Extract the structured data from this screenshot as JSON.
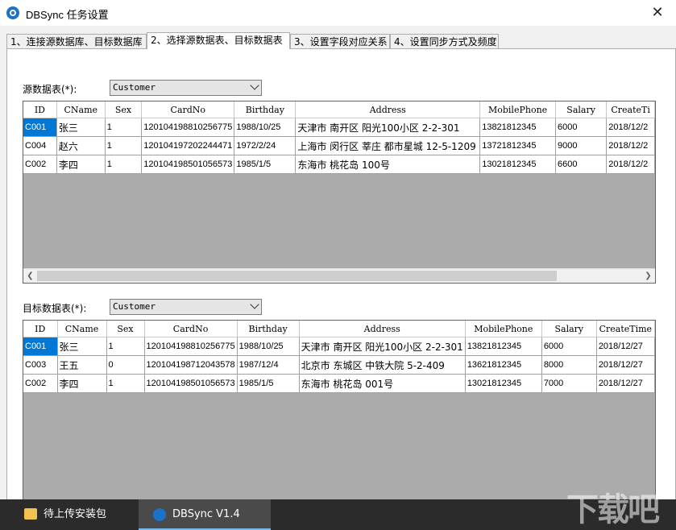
{
  "window": {
    "title": "DBSync 任务设置",
    "close": "✕"
  },
  "tabs": [
    "1、连接源数据库、目标数据库",
    "2、选择源数据表、目标数据表",
    "3、设置字段对应关系",
    "4、设置同步方式及频度"
  ],
  "source": {
    "label": "源数据表(*):",
    "selected": "Customer",
    "columns": [
      "ID",
      "CName",
      "Sex",
      "CardNo",
      "Birthday",
      "Address",
      "MobilePhone",
      "Salary",
      "CreateTi"
    ],
    "rows": [
      [
        "C001",
        "张三",
        "1",
        "120104198810256775",
        "1988/10/25",
        "天津市 南开区 阳光100小区 2-2-301",
        "13821812345",
        "6000",
        "2018/12/2"
      ],
      [
        "C004",
        "赵六",
        "1",
        "120104197202244471",
        "1972/2/24",
        "上海市 闵行区 莘庄 都市星城 12-5-1209",
        "13721812345",
        "9000",
        "2018/12/2"
      ],
      [
        "C002",
        "李四",
        "1",
        "120104198501056573",
        "1985/1/5",
        "东海市 桃花岛 100号",
        "13021812345",
        "6600",
        "2018/12/2"
      ]
    ]
  },
  "target": {
    "label": "目标数据表(*):",
    "selected": "Customer",
    "columns": [
      "ID",
      "CName",
      "Sex",
      "CardNo",
      "Birthday",
      "Address",
      "MobilePhone",
      "Salary",
      "CreateTime"
    ],
    "rows": [
      [
        "C001",
        "张三",
        "1",
        "120104198810256775",
        "1988/10/25",
        "天津市 南开区 阳光100小区 2-2-301",
        "13821812345",
        "6000",
        "2018/12/27"
      ],
      [
        "C003",
        "王五",
        "0",
        "120104198712043578",
        "1987/12/4",
        "北京市 东城区 中铁大院 5-2-409",
        "13621812345",
        "8000",
        "2018/12/27"
      ],
      [
        "C002",
        "李四",
        "1",
        "120104198501056573",
        "1985/1/5",
        "东海市 桃花岛 001号",
        "13021812345",
        "7000",
        "2018/12/27"
      ]
    ]
  },
  "taskbar": {
    "folder": "待上传安装包",
    "app": "DBSync V1.4"
  },
  "watermark": "下载吧"
}
